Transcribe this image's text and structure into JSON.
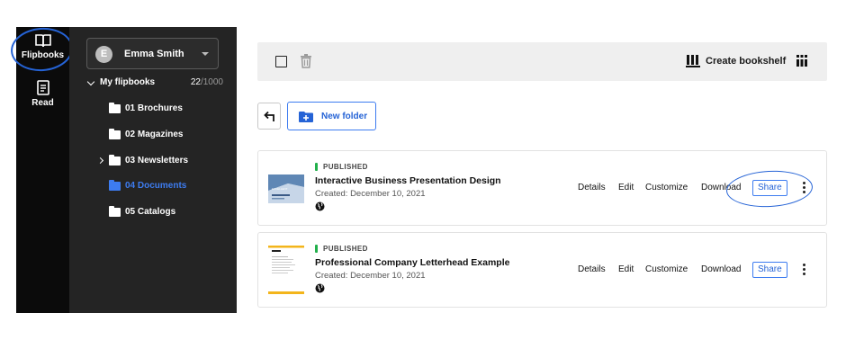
{
  "rail": {
    "items": [
      {
        "label": "Flipbooks",
        "icon": "book-open-icon",
        "active": true
      },
      {
        "label": "Read",
        "icon": "document-icon",
        "active": false
      }
    ]
  },
  "user": {
    "initial": "E",
    "name": "Emma Smith"
  },
  "tree": {
    "root_label": "My flipbooks",
    "count_used": "22",
    "count_total": "/1000",
    "folders": [
      {
        "label": "01 Brochures",
        "active": false,
        "expandable": false
      },
      {
        "label": "02 Magazines",
        "active": false,
        "expandable": false
      },
      {
        "label": "03 Newsletters",
        "active": false,
        "expandable": true
      },
      {
        "label": "04 Documents",
        "active": true,
        "expandable": false
      },
      {
        "label": "05 Catalogs",
        "active": false,
        "expandable": false
      }
    ]
  },
  "toolbar": {
    "create_bookshelf_label": "Create bookshelf"
  },
  "new_folder_label": "New folder",
  "flipbooks": [
    {
      "status": "PUBLISHED",
      "title": "Interactive Business Presentation Design",
      "created": "Created: December 10, 2021",
      "thumb_caption": "EXCELLENT",
      "actions": {
        "details": "Details",
        "edit": "Edit",
        "customize": "Customize",
        "download": "Download",
        "share": "Share"
      }
    },
    {
      "status": "PUBLISHED",
      "title": "Professional Company Letterhead Example",
      "created": "Created: December 10, 2021",
      "actions": {
        "details": "Details",
        "edit": "Edit",
        "customize": "Customize",
        "download": "Download",
        "share": "Share"
      }
    }
  ],
  "colors": {
    "accent": "#2563d6",
    "published": "#22b04b",
    "rail_bg": "#0b0b0b",
    "tree_bg": "#242424"
  }
}
